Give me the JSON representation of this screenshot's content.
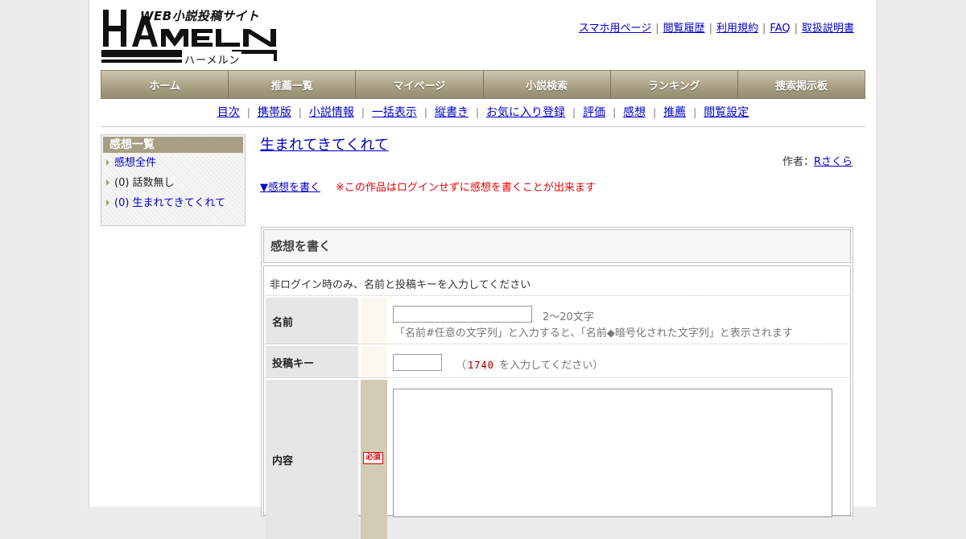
{
  "header": {
    "logo_caption": "WEB小説投稿サイト",
    "logo_text": "HAMELN",
    "logo_kana": "ハーメルン",
    "top_links": [
      "スマホ用ページ",
      "閲覧履歴",
      "利用規約",
      "FAQ",
      "取扱説明書"
    ]
  },
  "main_nav": [
    "ホーム",
    "推薦一覧",
    "マイページ",
    "小説検索",
    "ランキング",
    "捜索掲示板"
  ],
  "sub_nav": [
    "目次",
    "携帯版",
    "小説情報",
    "一括表示",
    "縦書き",
    "お気に入り登録",
    "評価",
    "感想",
    "推薦",
    "閲覧設定"
  ],
  "sidebar": {
    "title": "感想一覧",
    "items": [
      {
        "label": "感想全件"
      },
      {
        "label": "(0) 話数無し"
      },
      {
        "label": "(0) 生まれてきてくれて"
      }
    ]
  },
  "novel": {
    "title": "生まれてきてくれて",
    "author_label": "作者：",
    "author_name": "Rさくら"
  },
  "write_link": "▼感想を書く",
  "notice": "※この作品はログインせずに感想を書くことが出来ます",
  "form": {
    "heading": "感想を書く",
    "instruction": "非ログイン時のみ、名前と投稿キーを入力してください",
    "name_label": "名前",
    "name_hint_length": "2～20文字",
    "name_hint_format": "「名前#任意の文字列」と入力すると、「名前◆暗号化された文字列」と表示されます",
    "key_label": "投稿キー",
    "key_open": "（",
    "key_code": "1740",
    "key_close": " を入力してください）",
    "content_label": "内容",
    "required_badge": "必須",
    "name_value": "",
    "key_value": "",
    "content_value": ""
  },
  "colors": {
    "nav_gold": "#aea489",
    "link_blue": "#0000cc",
    "notice_red": "#ee0000"
  }
}
